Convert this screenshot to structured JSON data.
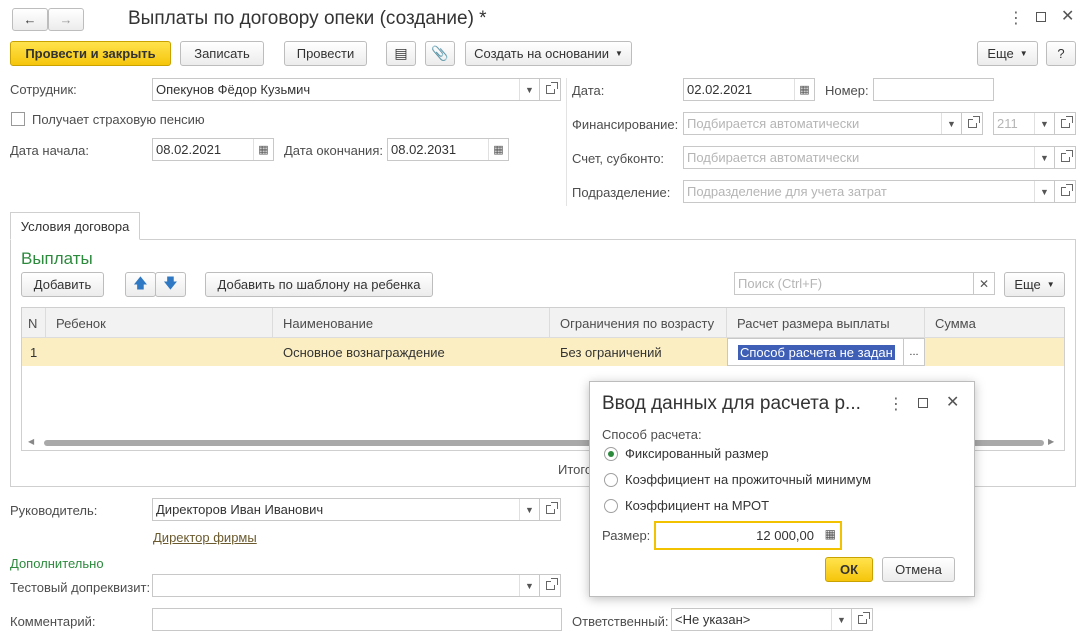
{
  "header": {
    "title": "Выплаты по договору опеки (создание) *",
    "nav_back": "←",
    "nav_forward": "→"
  },
  "toolbar": {
    "post_close": "Провести и закрыть",
    "save": "Записать",
    "post": "Провести",
    "create_based": "Создать на основании",
    "more": "Еще",
    "help": "?"
  },
  "form": {
    "employee_label": "Сотрудник:",
    "employee_value": "Опекунов Фёдор Кузьмич",
    "pension_label": "Получает страховую пенсию",
    "start_label": "Дата начала:",
    "start_value": "08.02.2021",
    "end_label": "Дата окончания:",
    "end_value": "08.02.2031",
    "date_label": "Дата:",
    "date_value": "02.02.2021",
    "number_label": "Номер:",
    "number_value": "",
    "financing_label": "Финансирование:",
    "financing_placeholder": "Подбирается автоматически",
    "financing_code": "211",
    "account_label": "Счет, субконто:",
    "account_placeholder": "Подбирается автоматически",
    "division_label": "Подразделение:",
    "division_placeholder": "Подразделение для учета затрат"
  },
  "tabs": [
    "Условия договора"
  ],
  "payments": {
    "title": "Выплаты",
    "add": "Добавить",
    "add_by_template": "Добавить по шаблону на ребенка",
    "search_placeholder": "Поиск (Ctrl+F)",
    "more": "Еще",
    "columns": [
      "N",
      "Ребенок",
      "Наименование",
      "Ограничения по возрасту",
      "Расчет размера выплаты",
      "Сумма"
    ],
    "rows": [
      {
        "n": "1",
        "child": "",
        "name": "Основное вознаграждение",
        "age": "Без ограничений",
        "calc": "Способ расчета не задан",
        "sum": ""
      }
    ],
    "total_label": "Итого"
  },
  "footer": {
    "head_label": "Руководитель:",
    "head_value": "Директоров Иван Иванович",
    "head_link": "Директор фирмы",
    "additional": "Дополнительно",
    "test_label": "Тестовый допреквизит:",
    "test_value": "",
    "comment_label": "Комментарий:",
    "comment_value": "",
    "responsible_label": "Ответственный:",
    "responsible_value": "<Не указан>"
  },
  "dialog": {
    "title": "Ввод данных для расчета р...",
    "method_label": "Способ расчета:",
    "options": [
      "Фиксированный размер",
      "Коэффициент на прожиточный минимум",
      "Коэффициент на МРОТ"
    ],
    "selected": 0,
    "size_label": "Размер:",
    "size_value": "12 000,00",
    "ok": "ОК",
    "cancel": "Отмена"
  },
  "colors": {
    "accent": "#f6c50b",
    "section_green": "#2c8a3d",
    "row_selected": "#fbeec2",
    "cell_selected": "#3f5fb7"
  }
}
